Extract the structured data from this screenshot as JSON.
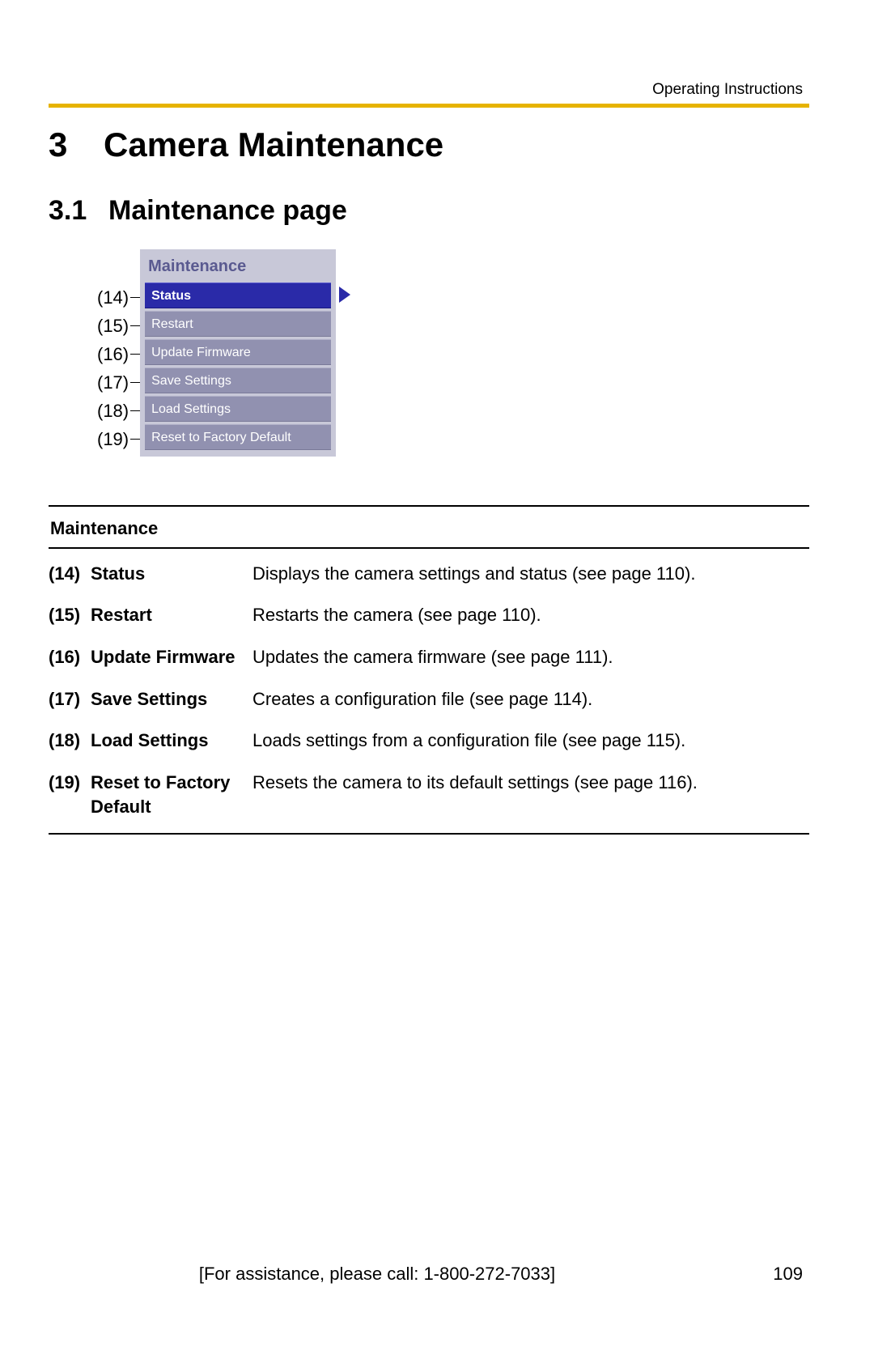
{
  "header": {
    "label": "Operating Instructions"
  },
  "section": {
    "number": "3",
    "title": "Camera Maintenance"
  },
  "subsection": {
    "number": "3.1",
    "title": "Maintenance page"
  },
  "menu": {
    "title": "Maintenance",
    "items": [
      {
        "callout": "(14)",
        "label": "Status",
        "active": true
      },
      {
        "callout": "(15)",
        "label": "Restart",
        "active": false
      },
      {
        "callout": "(16)",
        "label": "Update Firmware",
        "active": false
      },
      {
        "callout": "(17)",
        "label": "Save Settings",
        "active": false
      },
      {
        "callout": "(18)",
        "label": "Load Settings",
        "active": false
      },
      {
        "callout": "(19)",
        "label": "Reset to Factory Default",
        "active": false
      }
    ]
  },
  "table": {
    "title": "Maintenance",
    "rows": [
      {
        "num": "(14)",
        "label": "Status",
        "text": "Displays the camera settings and status (see page 110)."
      },
      {
        "num": "(15)",
        "label": "Restart",
        "text": "Restarts the camera (see page 110)."
      },
      {
        "num": "(16)",
        "label": "Update Firmware",
        "text": "Updates the camera firmware (see page 111)."
      },
      {
        "num": "(17)",
        "label": "Save Settings",
        "text": "Creates a configuration file (see page 114)."
      },
      {
        "num": "(18)",
        "label": "Load Settings",
        "text": "Loads settings from a configuration file (see page 115)."
      },
      {
        "num": "(19)",
        "label": "Reset to Factory Default",
        "text": "Resets the camera to its default settings (see page 116)."
      }
    ]
  },
  "footer": {
    "assist": "[For assistance, please call: 1-800-272-7033]",
    "page": "109"
  }
}
